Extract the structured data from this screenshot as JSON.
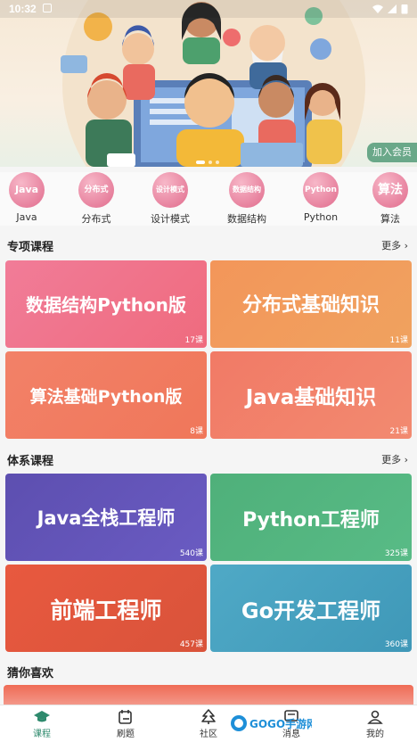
{
  "status_bar": {
    "time": "10:32"
  },
  "hero": {
    "join_label": "加入会员"
  },
  "categories": [
    {
      "badge": "Java",
      "label": "Java"
    },
    {
      "badge": "分布式",
      "label": "分布式"
    },
    {
      "badge": "设计模式",
      "label": "设计模式"
    },
    {
      "badge": "数据结构",
      "label": "数据结构"
    },
    {
      "badge": "Python",
      "label": "Python"
    },
    {
      "badge": "算法",
      "label": "算法"
    }
  ],
  "special": {
    "title": "专项课程",
    "more": "更多",
    "cards": [
      {
        "name": "数据结构Python版",
        "count": "17课"
      },
      {
        "name": "分布式基础知识",
        "count": "11课"
      },
      {
        "name": "算法基础Python版",
        "count": "8课"
      },
      {
        "name": "Java基础知识",
        "count": "21课"
      }
    ]
  },
  "system": {
    "title": "体系课程",
    "more": "更多",
    "cards": [
      {
        "name": "Java全栈工程师",
        "count": "540课"
      },
      {
        "name": "Python工程师",
        "count": "325课"
      },
      {
        "name": "前端工程师",
        "count": "457课"
      },
      {
        "name": "Go开发工程师",
        "count": "360课"
      }
    ]
  },
  "guess": {
    "title": "猜你喜欢"
  },
  "nav": [
    {
      "label": "课程",
      "icon": "graduation-cap-icon"
    },
    {
      "label": "刷题",
      "icon": "calendar-edit-icon"
    },
    {
      "label": "社区",
      "icon": "tree-icon"
    },
    {
      "label": "消息",
      "icon": "message-icon"
    },
    {
      "label": "我的",
      "icon": "person-icon"
    }
  ],
  "watermark": "GOGO手游网"
}
